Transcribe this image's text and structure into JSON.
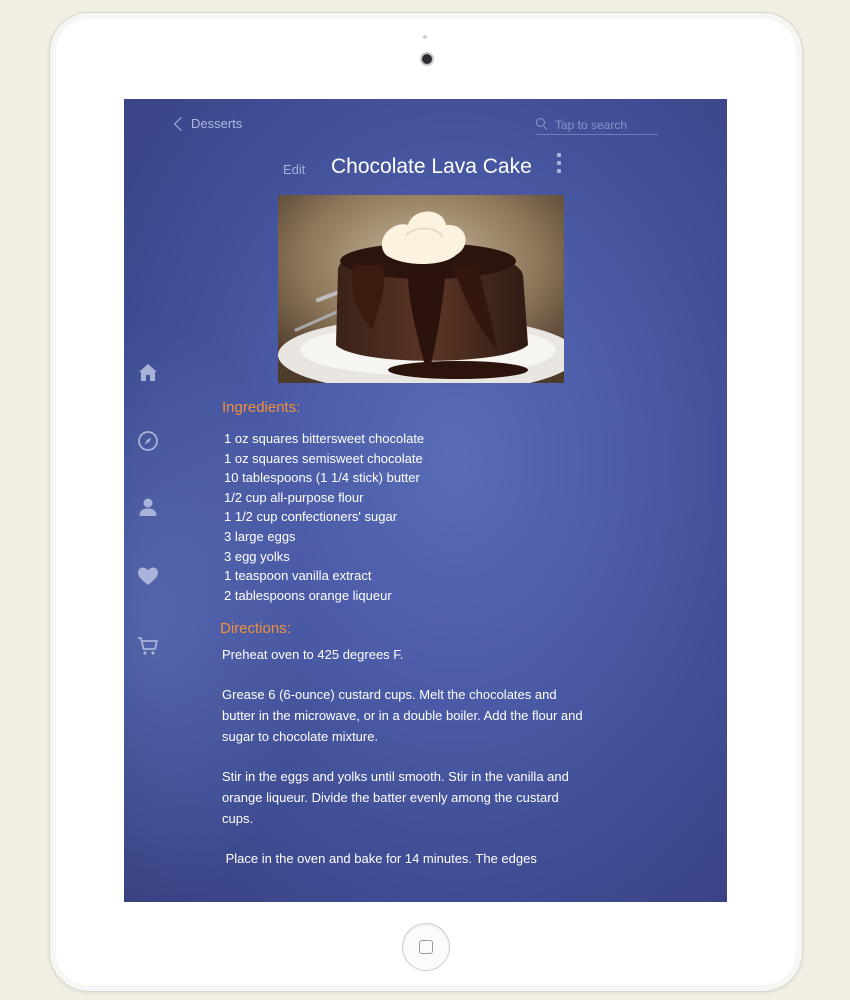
{
  "nav": {
    "back_label": "Desserts"
  },
  "search": {
    "placeholder": "Tap to search"
  },
  "header": {
    "edit_label": "Edit",
    "title": "Chocolate Lava Cake"
  },
  "sidebar": {
    "items": [
      {
        "name": "home-icon"
      },
      {
        "name": "compass-icon"
      },
      {
        "name": "user-icon"
      },
      {
        "name": "heart-icon"
      },
      {
        "name": "cart-icon"
      }
    ]
  },
  "recipe": {
    "ingredients_heading": "Ingredients:",
    "ingredients": [
      "1 oz squares bittersweet chocolate",
      "1 oz squares semisweet chocolate",
      "10 tablespoons (1 1/4 stick) butter",
      "1/2 cup all-purpose flour",
      "1 1/2 cup confectioners' sugar",
      "3 large eggs",
      "3 egg yolks",
      "1 teaspoon vanilla extract",
      "2 tablespoons orange liqueur"
    ],
    "directions_heading": "Directions:",
    "directions": [
      "Preheat oven to 425 degrees F.",
      "Grease 6 (6-ounce) custard cups. Melt the chocolates and butter in the microwave, or in a double boiler. Add the flour and sugar to chocolate mixture.",
      "Stir in the eggs and yolks until smooth. Stir in the vanilla and orange liqueur. Divide the batter evenly among the custard cups.",
      " Place in the oven and bake for 14 minutes. The edges"
    ]
  },
  "colors": {
    "accent_orange": "#f0903a",
    "screen_blue": "#4c5ca8",
    "icon_gray": "#a9b2d8"
  }
}
